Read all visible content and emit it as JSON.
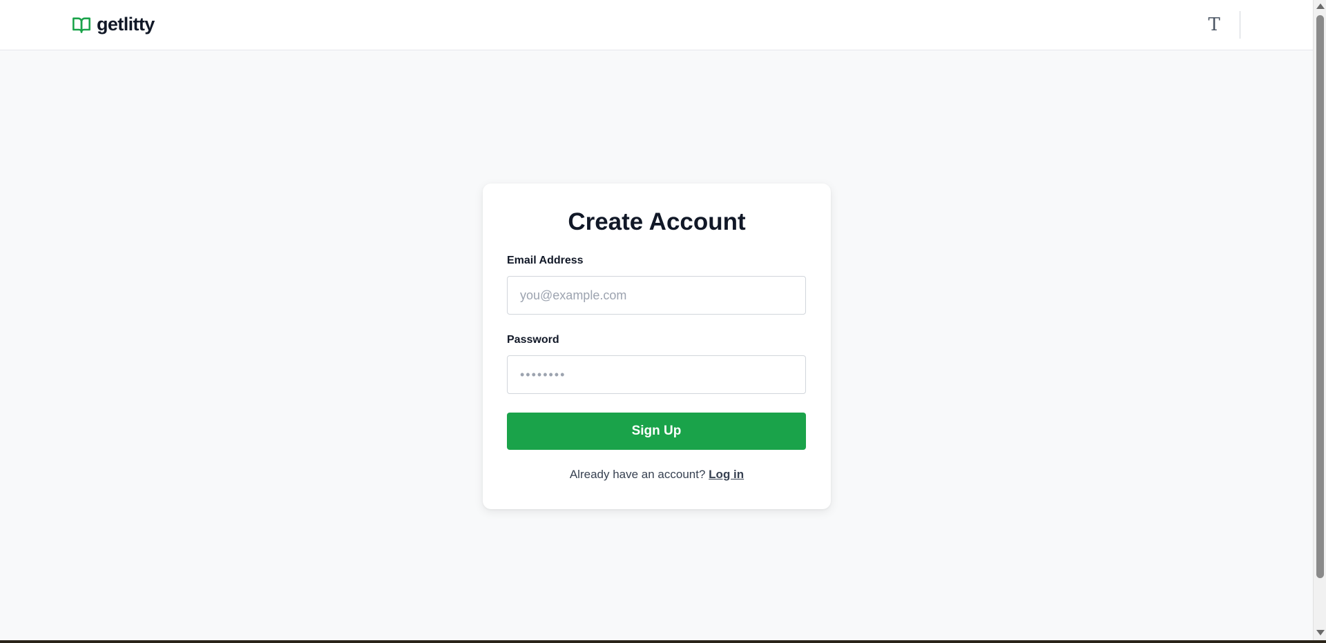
{
  "header": {
    "logo_text": "getlitty",
    "logo_icon": "open-book-icon",
    "font_toggle_label": "T",
    "font_toggle_icon": "font-serif-icon"
  },
  "signup": {
    "title": "Create Account",
    "email_label": "Email Address",
    "email_placeholder": "you@example.com",
    "email_value": "",
    "password_label": "Password",
    "password_placeholder": "••••••••",
    "password_value": "",
    "submit_label": "Sign Up",
    "login_prompt": "Already have an account?",
    "login_link": "Log in"
  },
  "colors": {
    "accent": "#1aa34a",
    "background": "#f8f9fa",
    "text": "#111827"
  }
}
